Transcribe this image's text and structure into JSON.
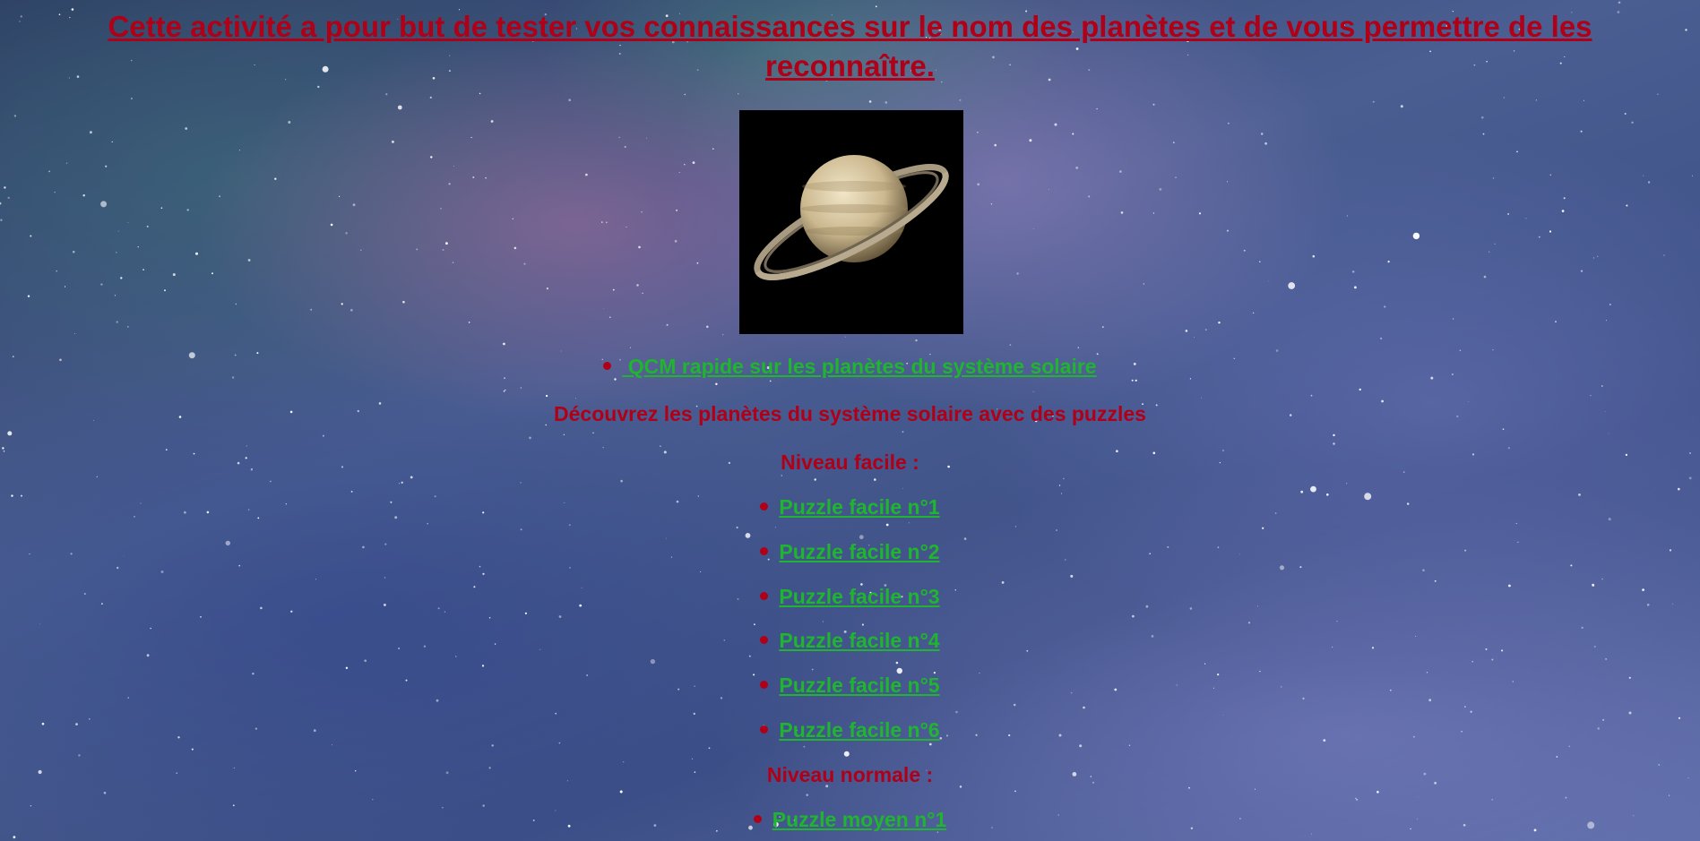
{
  "title": "Cette activité a pour but de tester vos connaissances sur le nom des planètes et de vous permettre de les reconnaître.",
  "image": {
    "icon": "saturn-planet-image"
  },
  "qcm_link": {
    "label": " QCM rapide sur les planètes du système solaire"
  },
  "intro": "Découvrez les planètes du système solaire avec des puzzles",
  "levels": [
    {
      "heading": "Niveau facile :",
      "puzzles": [
        "Puzzle facile n°1",
        "Puzzle facile n°2",
        "Puzzle facile n°3",
        "Puzzle facile n°4",
        "Puzzle facile n°5",
        "Puzzle facile n°6"
      ]
    },
    {
      "heading": "Niveau normale :",
      "puzzles": [
        "Puzzle moyen n°1"
      ]
    }
  ],
  "colors": {
    "title_red": "#b00018",
    "link_green": "#1fb52e",
    "bullet_red": "#b00018"
  }
}
